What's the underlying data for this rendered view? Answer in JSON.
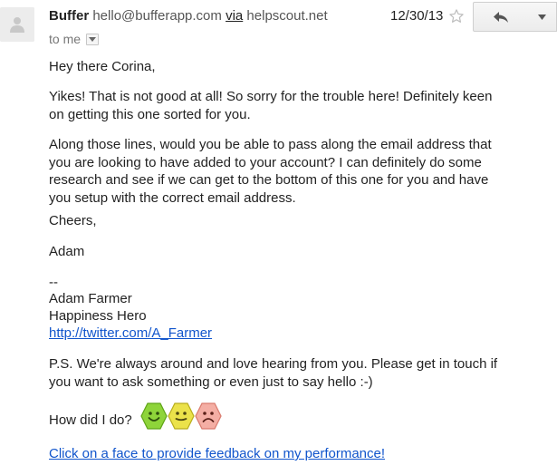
{
  "header": {
    "sender_name": "Buffer",
    "sender_email": "hello@bufferapp.com",
    "via_label": "via",
    "via_domain": "helpscout.net",
    "recipient": "to me",
    "date": "12/30/13",
    "icons": {
      "avatar": "person-silhouette-icon",
      "details": "caret-down-icon",
      "star": "star-outline-icon",
      "reply": "reply-arrow-icon",
      "more": "caret-down-icon"
    }
  },
  "body": {
    "greeting": "Hey there Corina,",
    "para1": "Yikes! That is not good at all! So sorry for the trouble here! Definitely keen\non getting this one sorted for you.",
    "para2": "Along those lines, would you be able to pass along the email address that\nyou are looking to have added to your account? I can definitely do some\nresearch and see if we can get to the bottom of this one for you and have\nyou setup with the correct email address.",
    "signoff": "Cheers,",
    "name": "Adam",
    "sig_separator": "--",
    "sig_name": "Adam Farmer",
    "sig_title": "Happiness Hero",
    "sig_link": "http://twitter.com/A_Farmer",
    "ps": "P.S. We're always around and love hearing from you. Please get in touch if\nyou want to ask something or even just to say hello :-)",
    "feedback_question": "How did I do?",
    "feedback_faces": [
      "happy-face-icon",
      "neutral-face-icon",
      "sad-face-icon"
    ],
    "feedback_link": "Click on a face to provide feedback on my performance!"
  },
  "colors": {
    "link": "#1155cc",
    "happy": "#7ed321",
    "neutral": "#e8df3a",
    "sad": "#f2a39a"
  }
}
